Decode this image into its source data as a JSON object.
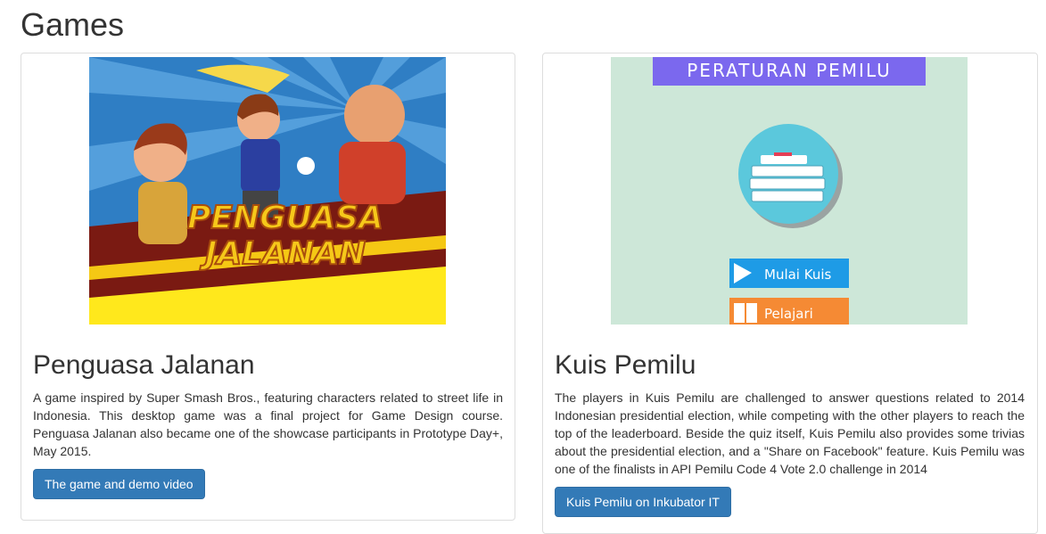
{
  "page": {
    "title": "Games"
  },
  "games": [
    {
      "title": "Penguasa Jalanan",
      "logo_line1": "PENGUASA",
      "logo_line2": "JALANAN",
      "description": "A game inspired by Super Smash Bros., featuring characters related to street life in Indonesia. This desktop game was a final project for Game Design course. Penguasa Jalanan also became one of the showcase participants in Prototype Day+, May 2015.",
      "button_label": "The game and demo video"
    },
    {
      "title": "Kuis Pemilu",
      "banner": "PERATURAN PEMILU",
      "menu_start": "Mulai Kuis",
      "menu_learn": "Pelajari",
      "description": "The players in Kuis Pemilu are challenged to answer questions related to 2014 Indonesian presidential election, while competing with the other players to reach the top of the leaderboard. Beside the quiz itself, Kuis Pemilu also provides some trivias about the presidential election, and a \"Share on Facebook\" feature. Kuis Pemilu was one of the finalists in API Pemilu Code 4 Vote 2.0 challenge in 2014",
      "button_label": "Kuis Pemilu on Inkubator IT"
    }
  ],
  "colors": {
    "button_bg": "#337ab7",
    "button_border": "#2e6da4",
    "kuis_bg": "#cde7d8",
    "kuis_banner": "#7b68ee",
    "kuis_circle": "#5bc8dc",
    "kuis_start": "#1e9be6",
    "kuis_learn": "#f58a34"
  }
}
